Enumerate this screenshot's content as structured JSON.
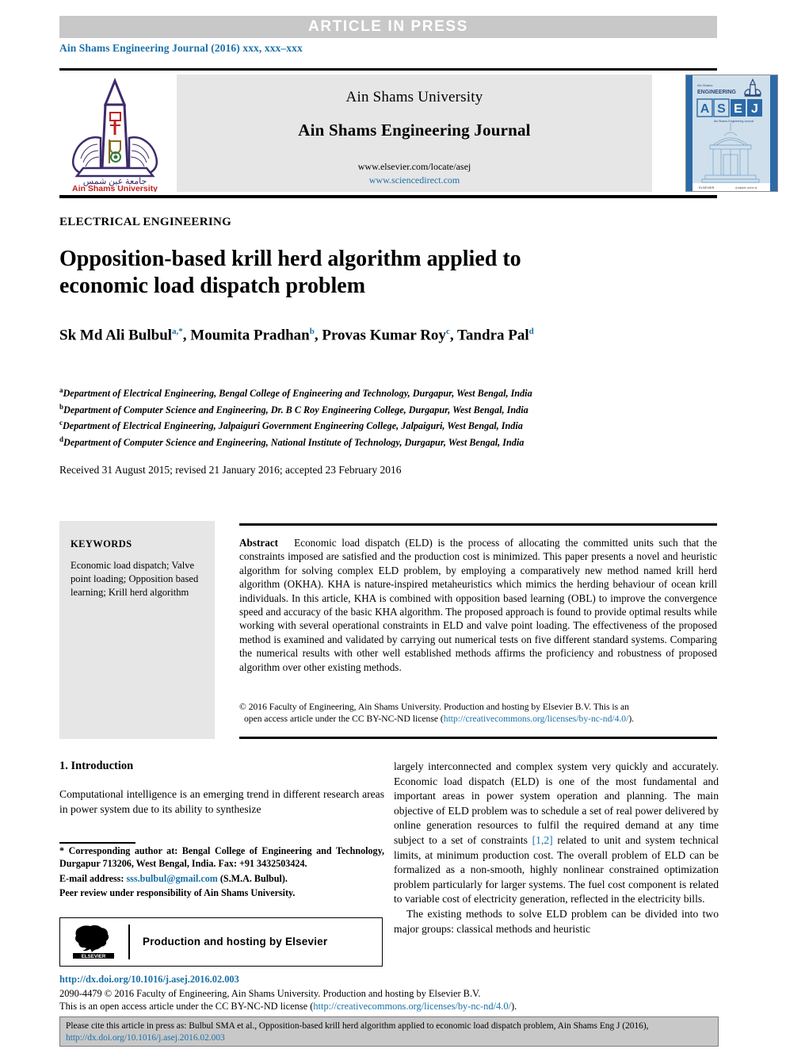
{
  "banner": {
    "text": "ARTICLE  IN  PRESS"
  },
  "journal_ref": "Ain Shams Engineering Journal (2016) xxx, xxx–xxx",
  "masthead": {
    "university": "Ain Shams University",
    "journal_title": "Ain Shams Engineering Journal",
    "url_elsevier": "www.elsevier.com/locate/asej",
    "url_sciencedirect": "www.sciencedirect.com",
    "logo_caption_arabic": "جامعة عين شمس",
    "logo_caption": "Ain Shams University",
    "cover": {
      "line_top": "Ain Shams",
      "line_eng": "ENGINEERING",
      "acronym": "ASEJ",
      "subtitle": "Ain Shams Engineering Journal",
      "publisher": "ELSEVIER"
    }
  },
  "section_label": "ELECTRICAL ENGINEERING",
  "title": "Opposition-based krill herd algorithm applied to economic load dispatch problem",
  "authors": [
    {
      "name": "Sk Md Ali Bulbul",
      "marks": "a,*"
    },
    {
      "name": "Moumita Pradhan",
      "marks": "b"
    },
    {
      "name": "Provas Kumar Roy",
      "marks": "c"
    },
    {
      "name": "Tandra Pal",
      "marks": "d"
    }
  ],
  "affiliations": [
    {
      "mark": "a",
      "text": "Department of Electrical Engineering, Bengal College of Engineering and Technology, Durgapur, West Bengal, India"
    },
    {
      "mark": "b",
      "text": "Department of Computer Science and Engineering, Dr. B C Roy Engineering College, Durgapur, West Bengal, India"
    },
    {
      "mark": "c",
      "text": "Department of Electrical Engineering, Jalpaiguri Government Engineering College, Jalpaiguri, West Bengal, India"
    },
    {
      "mark": "d",
      "text": "Department of Computer Science and Engineering, National Institute of Technology, Durgapur, West Bengal, India"
    }
  ],
  "history": "Received 31 August 2015; revised 21 January 2016; accepted 23 February 2016",
  "keywords": {
    "heading": "KEYWORDS",
    "items": "Economic load dispatch; Valve point loading; Opposition based learning; Krill herd algorithm"
  },
  "abstract": {
    "label": "Abstract",
    "text": "Economic load dispatch (ELD) is the process of allocating the committed units such that the constraints imposed are satisfied and the production cost is minimized. This paper presents a novel and heuristic algorithm for solving complex ELD problem, by employing a comparatively new method named krill herd algorithm (OKHA). KHA is nature-inspired metaheuristics which mimics the herding behaviour of ocean krill individuals. In this article, KHA is combined with opposition based learning (OBL) to improve the convergence speed and accuracy of the basic KHA algorithm. The proposed approach is found to provide optimal results while working with several operational constraints in ELD and valve point loading. The effectiveness of the proposed method is examined and validated by carrying out numerical tests on five different standard systems. Comparing the numerical results with other well established methods affirms the proficiency and robustness of proposed algorithm over other existing methods."
  },
  "copyright": {
    "line1": "© 2016 Faculty of Engineering, Ain Shams University. Production and hosting by Elsevier B.V. This is an",
    "line2_pre": "open access article under the CC BY-NC-ND license (",
    "line2_link": "http://creativecommons.org/licenses/by-nc-nd/4.0/",
    "line2_post": ")."
  },
  "intro": {
    "heading": "1. Introduction",
    "para_left": "Computational intelligence is an emerging trend in different research areas in power system due to its ability to synthesize",
    "para_right_1": "largely interconnected and complex system very quickly and accurately. Economic load dispatch (ELD) is one of the most fundamental and important areas in power system operation and planning. The main objective of ELD problem was to schedule a set of real power delivered by online generation resources to fulfil the required demand at any time subject to a set of constraints ",
    "para_right_ref": "[1,2]",
    "para_right_2": " related to unit and system technical limits, at minimum production cost. The overall problem of ELD can be formalized as a non-smooth, highly nonlinear constrained optimization problem particularly for larger systems. The fuel cost component is related to variable cost of electricity generation, reflected in the electricity bills.",
    "para_right_3": "The existing methods to solve ELD problem can be divided into two major groups: classical methods and heuristic"
  },
  "footnote": {
    "star": "*",
    "corresponding": "Corresponding author at: Bengal College of Engineering and Technology, Durgapur 713206, West Bengal, India. Fax: +91 3432503424.",
    "email_label": "E-mail address:",
    "email": "sss.bulbul@gmail.com",
    "email_suffix": "(S.M.A. Bulbul).",
    "peer_review": "Peer review under responsibility of Ain Shams University."
  },
  "elsevier_box": {
    "logo_label": "ELSEVIER",
    "text": "Production and hosting by Elsevier"
  },
  "doi": "http://dx.doi.org/10.1016/j.asej.2016.02.003",
  "imprint": {
    "line1": "2090-4479 © 2016 Faculty of Engineering, Ain Shams University. Production and hosting by Elsevier B.V.",
    "line2_pre": "This is an open access article under the CC BY-NC-ND license (",
    "line2_link": "http://creativecommons.org/licenses/by-nc-nd/4.0/",
    "line2_post": ")."
  },
  "citation": {
    "line1": "Please cite this article in press as: Bulbul SMA et al., Opposition-based krill herd algorithm applied to economic load dispatch problem, Ain Shams Eng J (2016),",
    "line2": "http://dx.doi.org/10.1016/j.asej.2016.02.003"
  },
  "colors": {
    "link": "#1a70a8",
    "banner_bg": "#c8c8c8",
    "panel_bg": "#e6e6e6",
    "logo_purple": "#3d2b6b",
    "logo_red": "#c02020"
  }
}
